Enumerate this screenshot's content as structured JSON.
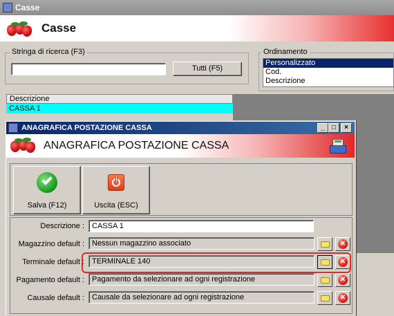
{
  "back_window": {
    "title": "Casse",
    "header_title": "Casse",
    "search": {
      "legend": "Stringa di ricerca (F3)",
      "value": "",
      "button_label": "Tutti (F5)"
    },
    "ordering": {
      "legend": "Ordinamento",
      "options": [
        "Personalizzato",
        "Cod.",
        "Descrizione"
      ],
      "selected_index": 0
    },
    "grid": {
      "column_header": "Descrizione",
      "selected_row": "CASSA 1"
    }
  },
  "dialog": {
    "title": "ANAGRAFICA POSTAZIONE CASSA",
    "header_title": "ANAGRAFICA POSTAZIONE CASSA",
    "window_buttons": {
      "minimize": "_",
      "maximize": "□",
      "close": "×"
    },
    "toolbar": {
      "save_label": "Salva (F12)",
      "exit_label": "Uscita (ESC)"
    },
    "fields": {
      "descrizione": {
        "label": "Descrizione :",
        "value": "CASSA 1"
      },
      "magazzino": {
        "label": "Magazzino default :",
        "value": "Nessun magazzino associato"
      },
      "terminale": {
        "label": "Terminale default :",
        "value": "TERMINALE 140"
      },
      "pagamento": {
        "label": "Pagamento default :",
        "value": "Pagamento da selezionare ad ogni registrazione"
      },
      "causale": {
        "label": "Causale default :",
        "value": "Causale da selezionare ad ogni registrazione"
      }
    }
  },
  "colors": {
    "title_active": "#0a246a",
    "highlight": "#e02a2a",
    "selected_row": "#00ffff"
  }
}
